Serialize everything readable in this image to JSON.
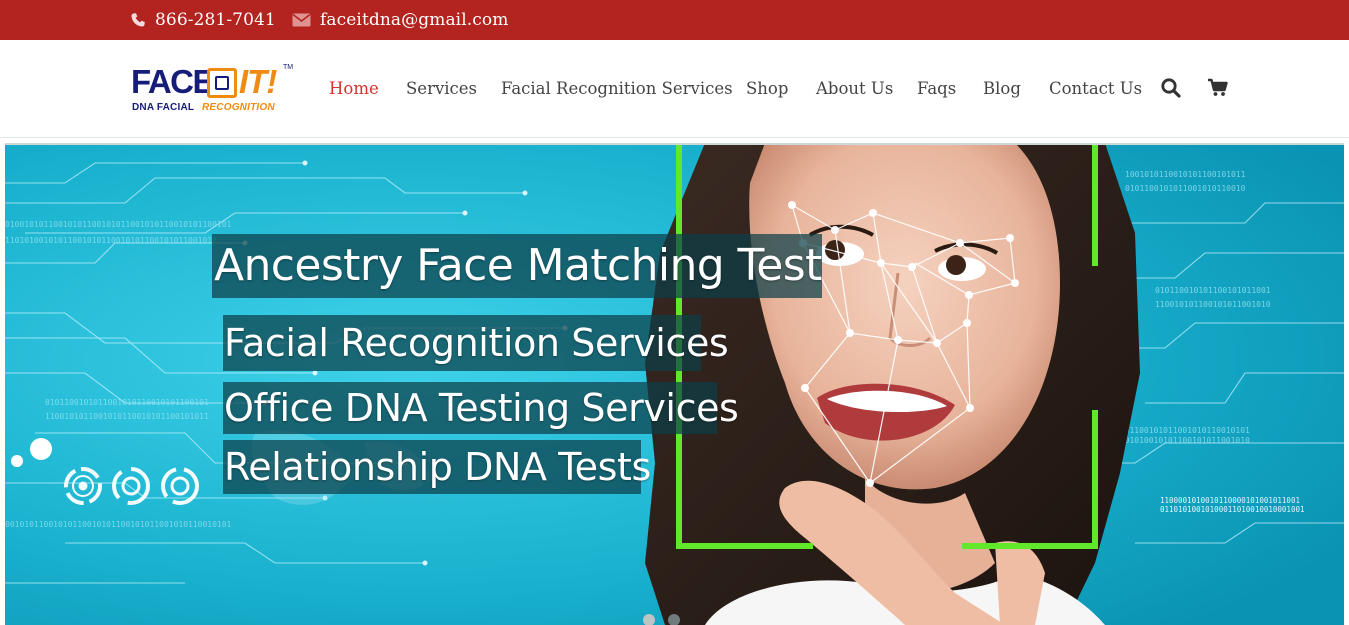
{
  "topbar": {
    "phone": "866-281-7041",
    "email": "faceitdna@gmail.com",
    "phone_icon": "phone-icon",
    "email_icon": "envelope-icon"
  },
  "logo": {
    "face": "FACE",
    "it": "IT!",
    "tm": "TM",
    "sub_line1": "DNA FACIAL",
    "sub_line2": "RECOGNITION"
  },
  "nav": {
    "items": [
      {
        "label": "Home",
        "active": true
      },
      {
        "label": "Services"
      },
      {
        "label": "Facial Recognition Services"
      },
      {
        "label": "Shop"
      },
      {
        "label": "About Us"
      },
      {
        "label": "Faqs"
      },
      {
        "label": "Blog"
      },
      {
        "label": "Contact Us"
      }
    ],
    "search_icon": "search-icon",
    "cart_icon": "cart-icon"
  },
  "hero": {
    "title": "Ancestry Face Matching Test",
    "lines": [
      "Facial Recognition Services",
      "Office DNA Testing Services",
      "Relationship DNA Tests"
    ],
    "slides": 2,
    "active_slide": 2
  },
  "colors": {
    "topbar_bg": "#b32420",
    "brand_navy": "#151d78",
    "brand_orange": "#f08a10",
    "nav_active": "#d2332c",
    "hero_bg": "#1db3cf",
    "frame_green": "#62e82b"
  }
}
